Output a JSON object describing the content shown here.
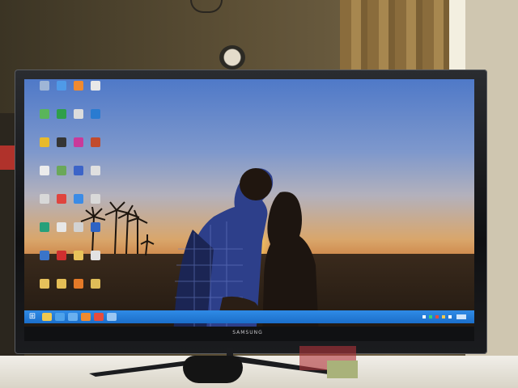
{
  "tv": {
    "brand": "SAMSUNG"
  },
  "desktop": {
    "icons": [
      {
        "name": "recycle-bin-icon",
        "color": "#9fb6d6"
      },
      {
        "name": "folder-icon",
        "color": "#4f9ae8"
      },
      {
        "name": "firefox-icon",
        "color": "#f08a2e"
      },
      {
        "name": "file-icon",
        "color": "#e8e8e8"
      },
      {
        "name": "app-icon",
        "color": "#5ab55a"
      },
      {
        "name": "app-icon",
        "color": "#2f9f49"
      },
      {
        "name": "file-icon",
        "color": "#dcdcdc"
      },
      {
        "name": "app-icon",
        "color": "#2a7bd1"
      },
      {
        "name": "app-icon",
        "color": "#e8ba2b"
      },
      {
        "name": "app-icon",
        "color": "#353535"
      },
      {
        "name": "app-icon",
        "color": "#c93a9a"
      },
      {
        "name": "app-icon",
        "color": "#c24b2c"
      },
      {
        "name": "file-icon",
        "color": "#ececec"
      },
      {
        "name": "app-icon",
        "color": "#6aa85a"
      },
      {
        "name": "app-icon",
        "color": "#3c64c8"
      },
      {
        "name": "file-icon",
        "color": "#e0e0e0"
      },
      {
        "name": "file-icon",
        "color": "#d8d8d8"
      },
      {
        "name": "chrome-icon",
        "color": "#e0443e"
      },
      {
        "name": "dropbox-icon",
        "color": "#3b8be6"
      },
      {
        "name": "file-icon",
        "color": "#d9d9d9"
      },
      {
        "name": "app-icon",
        "color": "#27a07a"
      },
      {
        "name": "file-icon",
        "color": "#e7e7e7"
      },
      {
        "name": "file-icon",
        "color": "#d2d2d2"
      },
      {
        "name": "app-icon",
        "color": "#2d63c4"
      },
      {
        "name": "app-icon",
        "color": "#3a74c8"
      },
      {
        "name": "acrobat-icon",
        "color": "#d12f2f"
      },
      {
        "name": "folder-icon",
        "color": "#e8c35a"
      },
      {
        "name": "file-icon",
        "color": "#e2e2e2"
      },
      {
        "name": "folder-icon",
        "color": "#e5c05b"
      },
      {
        "name": "folder-icon",
        "color": "#e4be56"
      },
      {
        "name": "app-icon",
        "color": "#e57a28"
      },
      {
        "name": "folder-icon",
        "color": "#dfbd58"
      }
    ]
  },
  "taskbar": {
    "start_glyph": "⊞",
    "items": [
      {
        "name": "explorer-taskbar-icon",
        "color": "#f1c94f"
      },
      {
        "name": "ie-taskbar-icon",
        "color": "#4ea2ea"
      },
      {
        "name": "app-taskbar-icon",
        "color": "#6ab0ef"
      },
      {
        "name": "firefox-taskbar-icon",
        "color": "#f18b30"
      },
      {
        "name": "chrome-taskbar-icon",
        "color": "#e74c3c"
      },
      {
        "name": "app-taskbar-icon",
        "color": "#9ac6f2"
      }
    ]
  }
}
